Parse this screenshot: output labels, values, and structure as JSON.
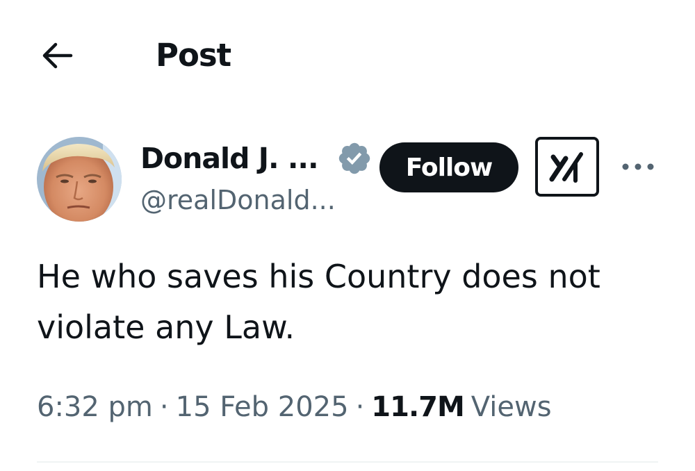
{
  "header": {
    "back_icon": "arrow-left-icon",
    "title": "Post"
  },
  "author": {
    "display_name": "Donald J. ...",
    "handle": "@realDonald...",
    "verified_icon": "verified-badge-icon",
    "verified_color": "#829aab",
    "avatar_icon": "profile-photo"
  },
  "actions": {
    "follow_label": "Follow",
    "grok_icon": "grok-icon",
    "more_icon": "more-horizontal-icon"
  },
  "post": {
    "text": "He who saves his Country does not violate any Law."
  },
  "meta": {
    "time": "6:32 pm",
    "separator": "·",
    "date": "15 Feb 2025",
    "views_count": "11.7M",
    "views_label": "Views"
  },
  "colors": {
    "text_primary": "#0f1419",
    "text_secondary": "#536471",
    "follow_bg": "#0f1419",
    "follow_text": "#ffffff",
    "divider": "#eff3f4"
  }
}
